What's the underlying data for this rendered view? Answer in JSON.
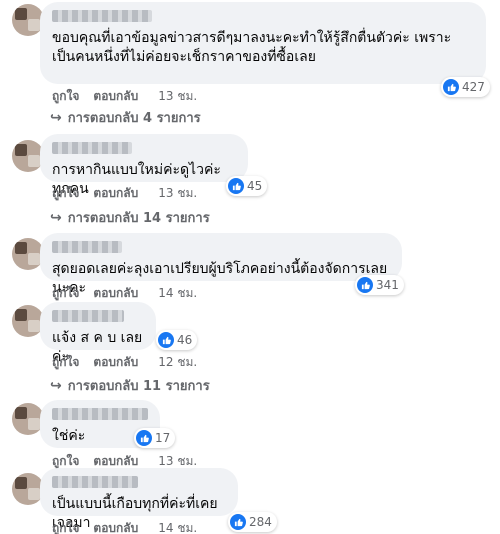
{
  "labels": {
    "like": "ถูกใจ",
    "reply": "ตอบกลับ",
    "like_color": "#1877f2"
  },
  "comments": [
    {
      "text": "ขอบคุณที่เอาข้อมูลข่าวสารดีๆมาลงนะคะทำให้รู้สึกตื่นตัวค่ะ เพราะเป็นคนหนึ่งที่ไม่ค่อยจะเช็กราคาของที่ซื้อเลย",
      "reactions": "427",
      "time": "13 ชม.",
      "replies": "การตอบกลับ 4 รายการ"
    },
    {
      "text": "การหากินแบบใหม่ค่ะดูไวค่ะทุกคน",
      "reactions": "45",
      "time": "13 ชม.",
      "replies": "การตอบกลับ 14 รายการ"
    },
    {
      "text": "สุดยอดเลยค่ะลุงเอาเปรียบผู้บริโภคอย่างนี้ต้องจัดการเลยนะคะ",
      "reactions": "341",
      "time": "14 ชม.",
      "replies": ""
    },
    {
      "text": "แจ้ง ส ค บ เลยค่ะ",
      "reactions": "46",
      "time": "12 ชม.",
      "replies": "การตอบกลับ 11 รายการ"
    },
    {
      "text": "ใช่ค่ะ",
      "reactions": "17",
      "time": "13 ชม.",
      "replies": ""
    },
    {
      "text": "เป็นแบบนี้เกือบทุกที่ค่ะที่เคยเจอมา",
      "reactions": "284",
      "time": "14 ชม.",
      "replies": ""
    }
  ]
}
